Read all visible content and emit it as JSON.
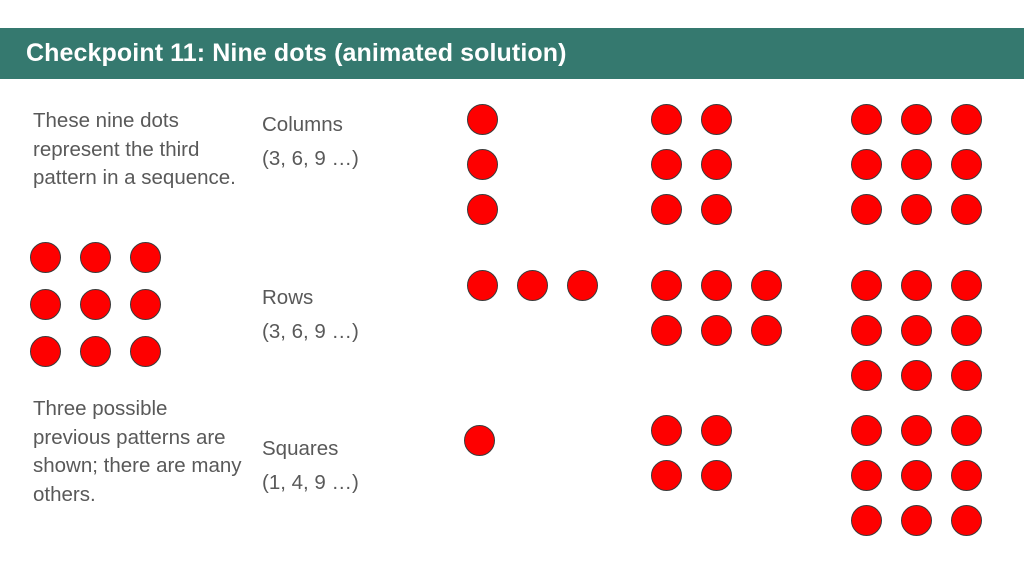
{
  "slide": {
    "title": "Checkpoint 11: Nine dots (animated solution)",
    "banner_color": "#35796f",
    "background_color": "#ffffff",
    "dot_color": "#fe0000",
    "text_color": "#595959"
  },
  "left_column": {
    "intro_text": "These nine dots represent the third pattern in a sequence.",
    "note_text": "Three possible previous patterns are shown; there are many others.",
    "sample_grid": {
      "name": "nine-dots",
      "rows": 3,
      "cols": 3,
      "count": 9
    }
  },
  "patterns": [
    {
      "id": "columns",
      "label": "Columns",
      "sequence": "(3, 6, 9 …)",
      "groups": [
        {
          "step": 1,
          "rows": 3,
          "cols": 1,
          "count": 3
        },
        {
          "step": 2,
          "rows": 3,
          "cols": 2,
          "count": 6
        },
        {
          "step": 3,
          "rows": 3,
          "cols": 3,
          "count": 9
        }
      ]
    },
    {
      "id": "rows",
      "label": "Rows",
      "sequence": "(3, 6, 9 …)",
      "groups": [
        {
          "step": 1,
          "rows": 1,
          "cols": 3,
          "count": 3
        },
        {
          "step": 2,
          "rows": 2,
          "cols": 3,
          "count": 6
        },
        {
          "step": 3,
          "rows": 3,
          "cols": 3,
          "count": 9
        }
      ]
    },
    {
      "id": "squares",
      "label": "Squares",
      "sequence": "(1, 4, 9 …)",
      "groups": [
        {
          "step": 1,
          "rows": 1,
          "cols": 1,
          "count": 1
        },
        {
          "step": 2,
          "rows": 2,
          "cols": 2,
          "count": 4
        },
        {
          "step": 3,
          "rows": 3,
          "cols": 3,
          "count": 9
        }
      ]
    }
  ]
}
